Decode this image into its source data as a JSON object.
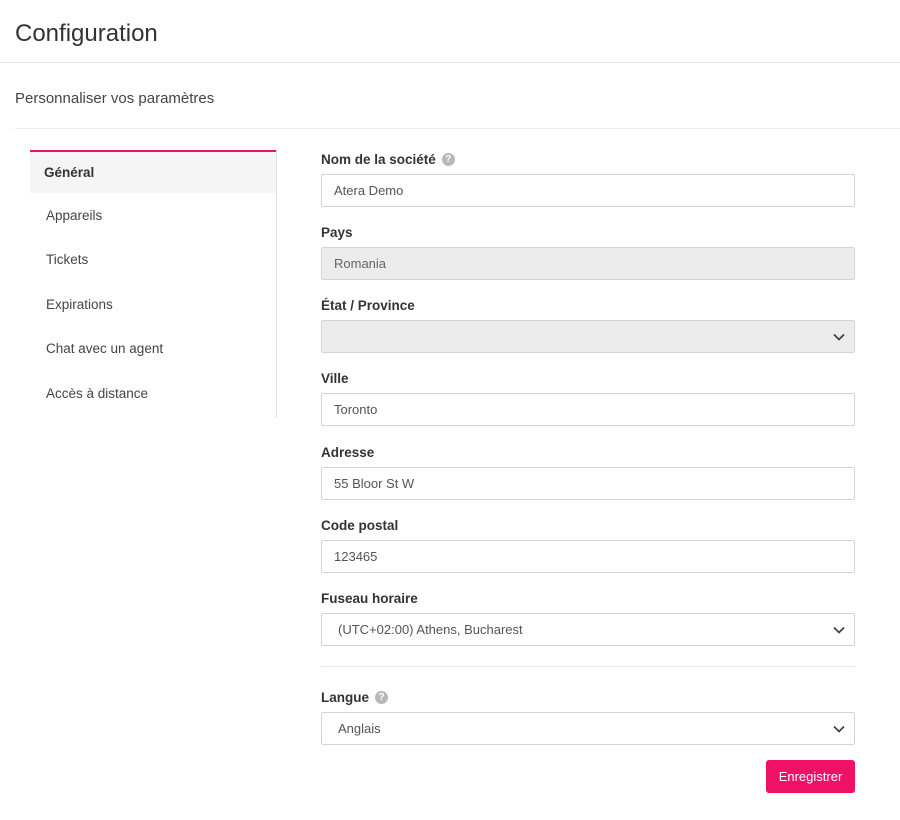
{
  "header": {
    "title": "Configuration"
  },
  "section": {
    "subtitle": "Personnaliser vos paramètres"
  },
  "sidebar": {
    "items": [
      {
        "label": "Général",
        "active": true
      },
      {
        "label": "Appareils"
      },
      {
        "label": "Tickets"
      },
      {
        "label": "Expirations"
      },
      {
        "label": "Chat avec un agent"
      },
      {
        "label": "Accès à distance"
      }
    ]
  },
  "form": {
    "company_name": {
      "label": "Nom de la société",
      "value": "Atera Demo"
    },
    "country": {
      "label": "Pays",
      "value": "Romania"
    },
    "state": {
      "label": "État / Province",
      "value": ""
    },
    "city": {
      "label": "Ville",
      "value": "Toronto"
    },
    "address": {
      "label": "Adresse",
      "value": "55 Bloor St W"
    },
    "postal_code": {
      "label": "Code postal",
      "value": "123465"
    },
    "timezone": {
      "label": "Fuseau horaire",
      "value": "(UTC+02:00) Athens, Bucharest"
    },
    "language": {
      "label": "Langue",
      "value": "Anglais"
    },
    "save_label": "Enregistrer"
  },
  "colors": {
    "accent": "#ee1166"
  }
}
